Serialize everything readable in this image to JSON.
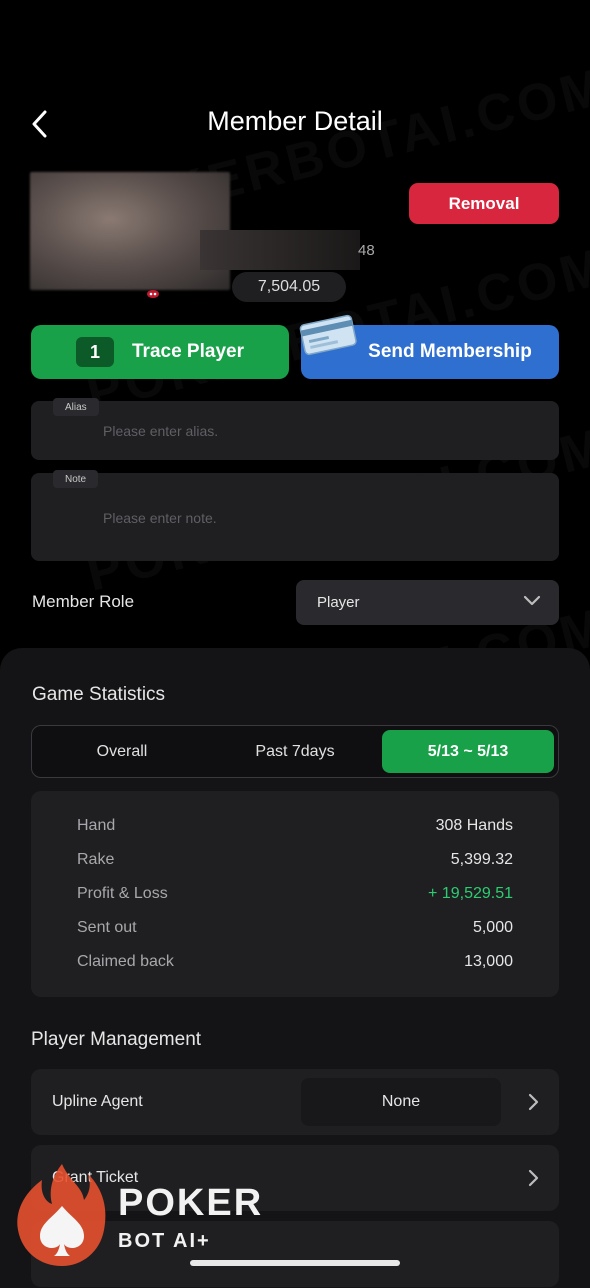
{
  "header": {
    "title": "Member Detail"
  },
  "profile": {
    "id_fragment": "48",
    "balance": "7,504.05",
    "removal_label": "Removal"
  },
  "actions": {
    "trace_count": "1",
    "trace_label": "Trace Player",
    "membership_label": "Send Membership"
  },
  "fields": {
    "alias": {
      "label": "Alias",
      "placeholder": "Please enter alias."
    },
    "note": {
      "label": "Note",
      "placeholder": "Please enter note."
    }
  },
  "member_role": {
    "label": "Member Role",
    "value": "Player"
  },
  "game_statistics": {
    "title": "Game Statistics",
    "tabs": [
      {
        "label": "Overall",
        "active": false
      },
      {
        "label": "Past 7days",
        "active": false
      },
      {
        "label": "5/13 ~ 5/13",
        "active": true
      }
    ],
    "rows": [
      {
        "label": "Hand",
        "value": "308 Hands"
      },
      {
        "label": "Rake",
        "value": "5,399.32"
      },
      {
        "label": "Profit & Loss",
        "value": "+ 19,529.51"
      },
      {
        "label": "Sent out",
        "value": "5,000"
      },
      {
        "label": "Claimed back",
        "value": "13,000"
      }
    ]
  },
  "player_management": {
    "title": "Player Management",
    "items": [
      {
        "label": "Upline Agent",
        "value": "None"
      },
      {
        "label": "Grant Ticket"
      }
    ]
  },
  "watermark": {
    "text": "POKERBOTAI.COM"
  },
  "logo": {
    "word": "POKER",
    "sub": "BOT AI+"
  },
  "colors": {
    "accent_green": "#18a148",
    "accent_blue": "#2f6fd0",
    "danger_red": "#d7263d",
    "profit_green": "#2ecc71",
    "background": "#000000",
    "card": "#1f1f22"
  },
  "icons": [
    "chevron-left-icon",
    "chevron-down-icon",
    "chevron-right-icon",
    "membership-card-icon",
    "flame-spade-logo-icon"
  ]
}
